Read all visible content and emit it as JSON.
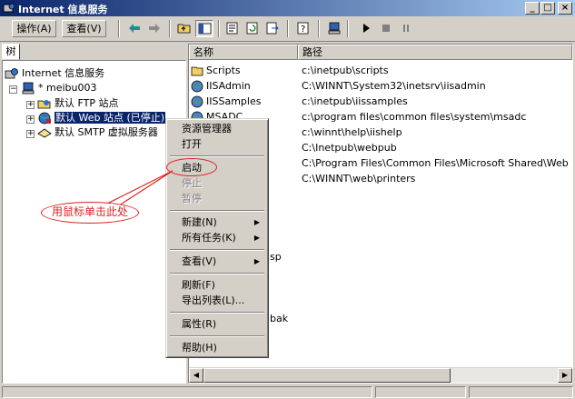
{
  "window": {
    "title": "Internet 信息服务",
    "min_label": "_",
    "max_label": "□",
    "close_label": "×"
  },
  "toolbar": {
    "action_menu": "操作(A)",
    "view_menu": "查看(V)",
    "icons": [
      "back-arrow-icon",
      "forward-arrow-icon",
      "up-folder-icon",
      "show-tree-icon",
      "properties-icon",
      "refresh-icon",
      "export-list-icon",
      "help-icon",
      "computer-icon",
      "start-icon",
      "stop-icon",
      "pause-icon"
    ]
  },
  "tree": {
    "tab_label": "树",
    "root": "Internet 信息服务",
    "server": "* meibu003",
    "plus": "+",
    "minus": "−",
    "items": [
      {
        "label": "默认 FTP 站点"
      },
      {
        "label": "默认 Web 站点 (已停止)"
      },
      {
        "label": "默认 SMTP 虚拟服务器"
      }
    ]
  },
  "list": {
    "columns": {
      "name": "名称",
      "path": "路径"
    },
    "rows": [
      {
        "name": "Scripts",
        "path": "c:\\inetpub\\scripts"
      },
      {
        "name": "IISAdmin",
        "path": "C:\\WINNT\\System32\\inetsrv\\iisadmin"
      },
      {
        "name": "IISSamples",
        "path": "c:\\inetpub\\iissamples"
      },
      {
        "name": "MSADC",
        "path": "c:\\program files\\common files\\system\\msadc"
      },
      {
        "name": "",
        "path": "c:\\winnt\\help\\iishelp"
      },
      {
        "name": "",
        "path": "C:\\Inetpub\\webpub"
      },
      {
        "name": "",
        "path": "C:\\Program Files\\Common Files\\Microsoft Shared\\Web Se..."
      },
      {
        "name": "",
        "path": "C:\\WINNT\\web\\printers"
      }
    ],
    "fragment_sp": "sp",
    "fragment_bak": "bak"
  },
  "context_menu": {
    "explorer": "资源管理器",
    "open": "打开",
    "start": "启动",
    "stop": "停止",
    "pause": "暂停",
    "new": "新建(N)",
    "all_tasks": "所有任务(K)",
    "view": "查看(V)",
    "refresh": "刷新(F)",
    "export": "导出列表(L)...",
    "properties": "属性(R)",
    "help": "帮助(H)",
    "submenu_arrow": "▶"
  },
  "annotation": {
    "callout": "用鼠标单击此处"
  },
  "colors": {
    "highlight": "#e02020",
    "selection": "#0a246a",
    "face": "#d4d0c8"
  }
}
